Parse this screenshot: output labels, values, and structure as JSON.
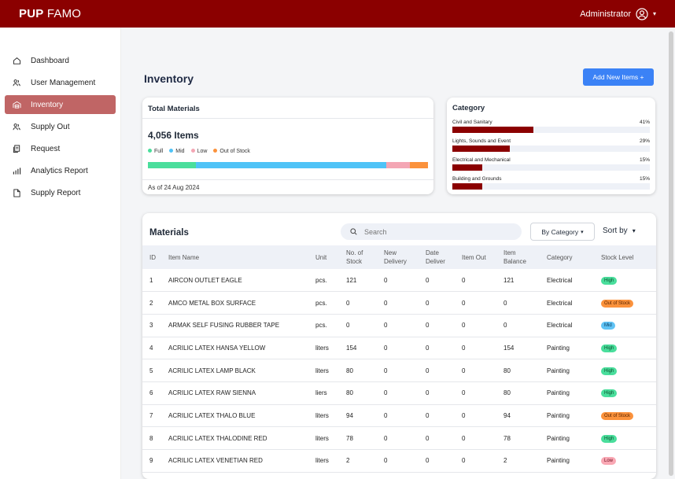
{
  "app": {
    "brand_bold": "PUP",
    "brand_rest": "FAMO",
    "user": "Administrator"
  },
  "sidebar": {
    "items": [
      {
        "label": "Dashboard",
        "icon": "home-icon",
        "active": false
      },
      {
        "label": "User Management",
        "icon": "users-icon",
        "active": false
      },
      {
        "label": "Inventory",
        "icon": "warehouse-icon",
        "active": true
      },
      {
        "label": "Supply Out",
        "icon": "users-icon",
        "active": false
      },
      {
        "label": "Request",
        "icon": "documents-icon",
        "active": false
      },
      {
        "label": "Analytics Report",
        "icon": "analytics-icon",
        "active": false
      },
      {
        "label": "Supply Report",
        "icon": "file-icon",
        "active": false
      }
    ]
  },
  "page": {
    "title": "Inventory",
    "add_button": "Add New Items +"
  },
  "total": {
    "title": "Total Materials",
    "count": "4,056 Items",
    "legend": [
      "Full",
      "Mid",
      "Low",
      "Out of Stock"
    ],
    "as_of": "As of 24 Aug 2024",
    "distribution": {
      "full": 0.17,
      "mid": 0.68,
      "low": 0.085,
      "out_of_stock": 0.065
    },
    "colors": {
      "full": "#4ade9c",
      "mid": "#4fc3f7",
      "low": "#f4a6b4",
      "out_of_stock": "#fb923c"
    }
  },
  "category": {
    "title": "Category",
    "items": [
      {
        "name": "Civil and Sanitary",
        "pct": "41%",
        "value": 41
      },
      {
        "name": "Lights, Sounds and Event",
        "pct": "29%",
        "value": 29
      },
      {
        "name": "Electrical and Mechanical",
        "pct": "15%",
        "value": 15
      },
      {
        "name": "Building and Grounds",
        "pct": "15%",
        "value": 15
      }
    ]
  },
  "materials": {
    "title": "Materials",
    "search_placeholder": "Search",
    "category_filter": "By Category",
    "sort_label": "Sort by",
    "headers": [
      "ID",
      "Item Name",
      "Unit",
      "No. of\nStock",
      "New\nDelivery",
      "Date\nDeliver",
      "Item Out",
      "Item\nBalance",
      "Category",
      "Stock Level"
    ],
    "rows": [
      {
        "id": "1",
        "name": "AIRCON OUTLET EAGLE",
        "unit": "pcs.",
        "stock": "121",
        "new": "0",
        "date": "0",
        "out": "0",
        "balance": "121",
        "category": "Electrical",
        "level": "High"
      },
      {
        "id": "2",
        "name": "AMCO METAL BOX SURFACE",
        "unit": "pcs.",
        "stock": "0",
        "new": "0",
        "date": "0",
        "out": "0",
        "balance": "0",
        "category": "Electrical",
        "level": "Out of Stock"
      },
      {
        "id": "3",
        "name": "ARMAK SELF FUSING RUBBER TAPE",
        "unit": "pcs.",
        "stock": "0",
        "new": "0",
        "date": "0",
        "out": "0",
        "balance": "0",
        "category": "Electrical",
        "level": "Mid"
      },
      {
        "id": "4",
        "name": "ACRILIC LATEX HANSA YELLOW",
        "unit": "liters",
        "stock": "154",
        "new": "0",
        "date": "0",
        "out": "0",
        "balance": "154",
        "category": "Painting",
        "level": "High"
      },
      {
        "id": "5",
        "name": "ACRILIC LATEX LAMP BLACK",
        "unit": "liters",
        "stock": "80",
        "new": "0",
        "date": "0",
        "out": "0",
        "balance": "80",
        "category": "Painting",
        "level": "High"
      },
      {
        "id": "6",
        "name": "ACRILIC LATEX RAW SIENNA",
        "unit": "liers",
        "stock": "80",
        "new": "0",
        "date": "0",
        "out": "0",
        "balance": "80",
        "category": "Painting",
        "level": "High"
      },
      {
        "id": "7",
        "name": "ACRILIC LATEX THALO BLUE",
        "unit": "liters",
        "stock": "94",
        "new": "0",
        "date": "0",
        "out": "0",
        "balance": "94",
        "category": "Painting",
        "level": "Out of Stock"
      },
      {
        "id": "8",
        "name": "ACRILIC LATEX THALODINE RED",
        "unit": "liters",
        "stock": "78",
        "new": "0",
        "date": "0",
        "out": "0",
        "balance": "78",
        "category": "Painting",
        "level": "High"
      },
      {
        "id": "9",
        "name": "ACRILIC LATEX VENETIAN RED",
        "unit": "liters",
        "stock": "2",
        "new": "0",
        "date": "0",
        "out": "0",
        "balance": "2",
        "category": "Painting",
        "level": "Low"
      }
    ]
  },
  "colors": {
    "brand": "#8b0000",
    "active_nav": "#c06565",
    "accent": "#3b82f6",
    "category_bar": "#8b0000"
  }
}
